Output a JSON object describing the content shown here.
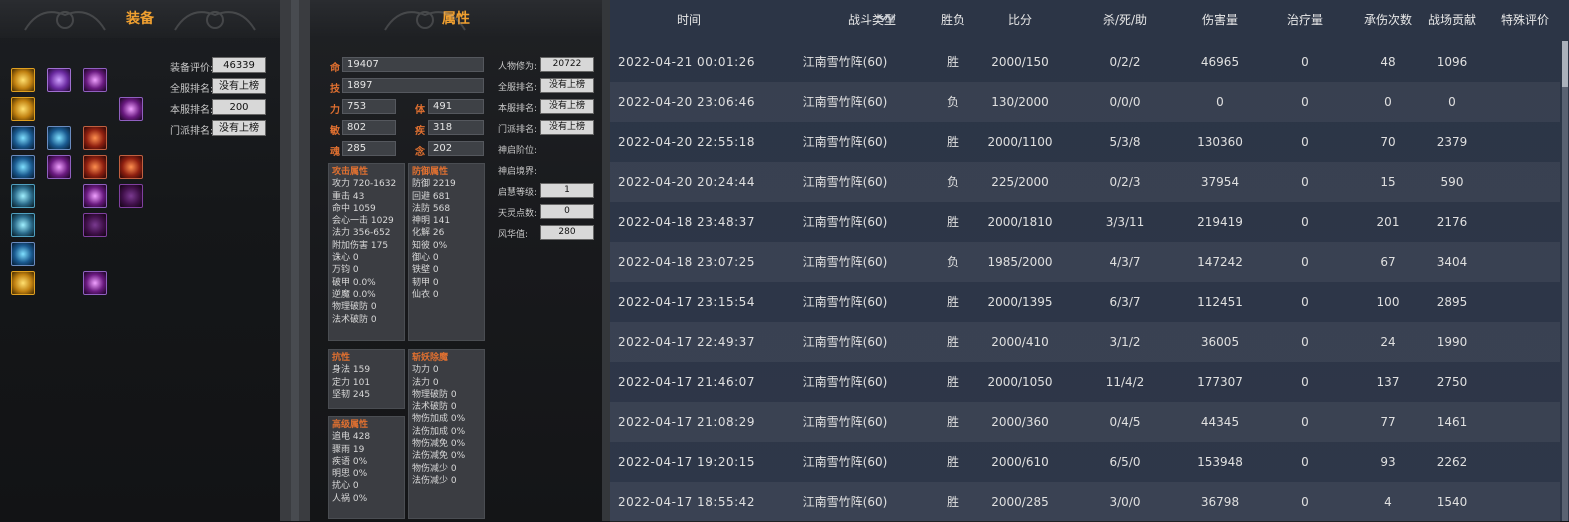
{
  "equipment": {
    "title": "装备",
    "ratings": [
      {
        "label": "装备评价:",
        "value": "46339"
      },
      {
        "label": "全服排名:",
        "value": "没有上榜"
      },
      {
        "label": "本服排名:",
        "value": "200"
      },
      {
        "label": "门派排名:",
        "value": "没有上榜"
      }
    ],
    "slots": [
      {
        "icon": "gold-orb-icon",
        "tint": "gold"
      },
      {
        "icon": "purple-gem-icon",
        "tint": "purple"
      },
      {
        "icon": "purple-helm-icon",
        "tint": "violet"
      },
      {
        "icon": "gold-ring-icon",
        "tint": "gold"
      },
      {
        "icon": "violet-charm-icon",
        "tint": "violet"
      },
      {
        "icon": "blue-arc-icon",
        "tint": "blue"
      },
      {
        "icon": "blue-feather-icon",
        "tint": "blue"
      },
      {
        "icon": "horned-mask-icon",
        "tint": "red"
      },
      {
        "icon": "blue-weapon-icon",
        "tint": "blue"
      },
      {
        "icon": "spear-icon",
        "tint": "violet"
      },
      {
        "icon": "demon-mask-icon",
        "tint": "red"
      },
      {
        "icon": "red-mask-icon",
        "tint": "red"
      },
      {
        "icon": "cyan-ring-icon",
        "tint": "cyan"
      },
      {
        "icon": "purple-armor-icon",
        "tint": "violet"
      },
      {
        "icon": "skull-icon",
        "tint": "dark"
      },
      {
        "icon": "cyan-bracer-icon",
        "tint": "cyan"
      },
      {
        "icon": "dark-robe-icon",
        "tint": "dark"
      },
      {
        "icon": "blue-necklace-icon",
        "tint": "blue"
      },
      {
        "icon": "gold-medal-icon",
        "tint": "gold"
      },
      {
        "icon": "purple-boots-icon",
        "tint": "violet"
      }
    ]
  },
  "attributes": {
    "title": "属性",
    "main": [
      {
        "label": "命",
        "value": "19407"
      },
      {
        "label": "技",
        "value": "1897"
      }
    ],
    "pairs": [
      {
        "l1": "力",
        "v1": "753",
        "l2": "体",
        "v2": "491"
      },
      {
        "l1": "敏",
        "v1": "802",
        "l2": "疾",
        "v2": "318"
      },
      {
        "l1": "魂",
        "v1": "285",
        "l2": "念",
        "v2": "202"
      }
    ],
    "right": [
      {
        "label": "人物修为:",
        "value": "20722"
      },
      {
        "label": "全服排名:",
        "value": "没有上榜"
      },
      {
        "label": "本服排名:",
        "value": "没有上榜"
      },
      {
        "label": "门派排名:",
        "value": "没有上榜"
      },
      {
        "label": "神启阶位:",
        "value": ""
      },
      {
        "label": "神启境界:",
        "value": ""
      },
      {
        "label": "启慧等级:",
        "value": "1"
      },
      {
        "label": "天灵点数:",
        "value": "0"
      },
      {
        "label": "风华值:",
        "value": "280"
      }
    ],
    "attack": {
      "title": "攻击属性",
      "lines": [
        "攻力 720-1632",
        "重击 43",
        "命中 1059",
        "会心一击 1029",
        "法力 356-652",
        "附加伤害 175",
        "诛心 0",
        "万钧 0",
        "破甲 0.0%",
        "逆魔 0.0%",
        "物理破防 0",
        "法术破防 0"
      ]
    },
    "defense": {
      "title": "防御属性",
      "lines": [
        "防御 2219",
        "回避 681",
        "法防 568",
        "神明 141",
        "化解 26",
        "知彼 0%",
        "御心 0",
        "铁壁 0",
        "韧甲 0",
        "仙衣 0"
      ]
    },
    "resist": {
      "title": "抗性",
      "lines": [
        "身法 159",
        "定力 101",
        "坚韧 245"
      ]
    },
    "advanced": {
      "title": "高级属性",
      "lines": [
        "追电 428",
        "骤雨 19",
        "疾语 0%",
        "明思 0%",
        "扰心 0",
        "人祸 0%"
      ]
    },
    "demon": {
      "title": "斩妖除魔",
      "lines": [
        "功力 0",
        "法力 0",
        "物理破防 0",
        "法术破防 0",
        "物伤加成 0%",
        "法伤加成 0%",
        "物伤减免 0%",
        "法伤减免 0%",
        "物伤减少 0",
        "法伤减少 0"
      ]
    }
  },
  "records": {
    "headers": {
      "time": "时间",
      "type": "战斗类型",
      "result": "胜负",
      "score": "比分",
      "kda": "杀/死/助",
      "damage": "伤害量",
      "heal": "治疗量",
      "taken": "承伤次数",
      "contrib": "战场贡献",
      "special": "特殊评价"
    },
    "rows": [
      {
        "time": "2022-04-21 00:01:26",
        "type": "江南雪竹阵(60)",
        "result": "胜",
        "score": "2000/150",
        "kda": "0/2/2",
        "damage": "46965",
        "heal": "0",
        "taken": "48",
        "contrib": "1096"
      },
      {
        "time": "2022-04-20 23:06:46",
        "type": "江南雪竹阵(60)",
        "result": "负",
        "score": "130/2000",
        "kda": "0/0/0",
        "damage": "0",
        "heal": "0",
        "taken": "0",
        "contrib": "0"
      },
      {
        "time": "2022-04-20 22:55:18",
        "type": "江南雪竹阵(60)",
        "result": "胜",
        "score": "2000/1100",
        "kda": "5/3/8",
        "damage": "130360",
        "heal": "0",
        "taken": "70",
        "contrib": "2379"
      },
      {
        "time": "2022-04-20 20:24:44",
        "type": "江南雪竹阵(60)",
        "result": "负",
        "score": "225/2000",
        "kda": "0/2/3",
        "damage": "37954",
        "heal": "0",
        "taken": "15",
        "contrib": "590"
      },
      {
        "time": "2022-04-18 23:48:37",
        "type": "江南雪竹阵(60)",
        "result": "胜",
        "score": "2000/1810",
        "kda": "3/3/11",
        "damage": "219419",
        "heal": "0",
        "taken": "201",
        "contrib": "2176"
      },
      {
        "time": "2022-04-18 23:07:25",
        "type": "江南雪竹阵(60)",
        "result": "负",
        "score": "1985/2000",
        "kda": "4/3/7",
        "damage": "147242",
        "heal": "0",
        "taken": "67",
        "contrib": "3404"
      },
      {
        "time": "2022-04-17 23:15:54",
        "type": "江南雪竹阵(60)",
        "result": "胜",
        "score": "2000/1395",
        "kda": "6/3/7",
        "damage": "112451",
        "heal": "0",
        "taken": "100",
        "contrib": "2895"
      },
      {
        "time": "2022-04-17 22:49:37",
        "type": "江南雪竹阵(60)",
        "result": "胜",
        "score": "2000/410",
        "kda": "3/1/2",
        "damage": "36005",
        "heal": "0",
        "taken": "24",
        "contrib": "1990"
      },
      {
        "time": "2022-04-17 21:46:07",
        "type": "江南雪竹阵(60)",
        "result": "胜",
        "score": "2000/1050",
        "kda": "11/4/2",
        "damage": "177307",
        "heal": "0",
        "taken": "137",
        "contrib": "2750"
      },
      {
        "time": "2022-04-17 21:08:29",
        "type": "江南雪竹阵(60)",
        "result": "胜",
        "score": "2000/360",
        "kda": "0/4/5",
        "damage": "44345",
        "heal": "0",
        "taken": "77",
        "contrib": "1461"
      },
      {
        "time": "2022-04-17 19:20:15",
        "type": "江南雪竹阵(60)",
        "result": "胜",
        "score": "2000/610",
        "kda": "6/5/0",
        "damage": "153948",
        "heal": "0",
        "taken": "93",
        "contrib": "2262"
      },
      {
        "time": "2022-04-17 18:55:42",
        "type": "江南雪竹阵(60)",
        "result": "胜",
        "score": "2000/285",
        "kda": "3/0/0",
        "damage": "36798",
        "heal": "0",
        "taken": "4",
        "contrib": "1540"
      }
    ]
  },
  "colors": {
    "accent": "#f0a030",
    "attr_label": "#e07030",
    "records_bg": "#2c3546"
  }
}
